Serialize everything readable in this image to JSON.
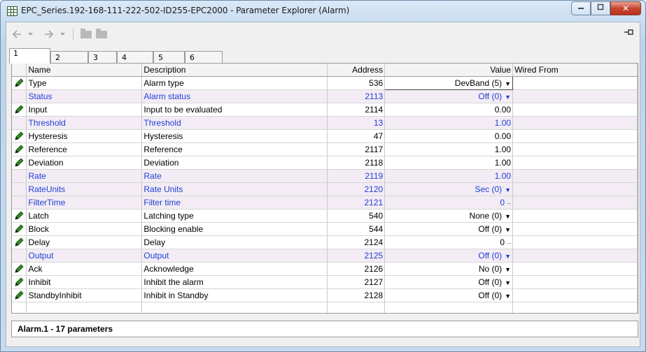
{
  "window": {
    "title": "EPC_Series.192-168-111-222-502-ID255-EPC2000 - Parameter Explorer (Alarm)",
    "close_label": "✕"
  },
  "tabs": [
    {
      "label": "1"
    },
    {
      "label": "2"
    },
    {
      "label": "3"
    },
    {
      "label": "4"
    },
    {
      "label": "5"
    },
    {
      "label": "6"
    }
  ],
  "table": {
    "columns": {
      "name": "Name",
      "description": "Description",
      "address": "Address",
      "value": "Value",
      "wired_from": "Wired From"
    },
    "rows": [
      {
        "name": "Type",
        "description": "Alarm type",
        "address": "536",
        "value": "DevBand (5)",
        "control": "dropdown",
        "editable": true,
        "highlight": false
      },
      {
        "name": "Status",
        "description": "Alarm status",
        "address": "2113",
        "value": "Off (0)",
        "control": "dropdown",
        "editable": false,
        "highlight": true
      },
      {
        "name": "Input",
        "description": "Input to be evaluated",
        "address": "2114",
        "value": "0.00",
        "control": "",
        "editable": true,
        "highlight": false
      },
      {
        "name": "Threshold",
        "description": "Threshold",
        "address": "13",
        "value": "1.00",
        "control": "",
        "editable": false,
        "highlight": true
      },
      {
        "name": "Hysteresis",
        "description": "Hysteresis",
        "address": "47",
        "value": "0.00",
        "control": "",
        "editable": true,
        "highlight": false
      },
      {
        "name": "Reference",
        "description": "Reference",
        "address": "2117",
        "value": "1.00",
        "control": "",
        "editable": true,
        "highlight": false
      },
      {
        "name": "Deviation",
        "description": "Deviation",
        "address": "2118",
        "value": "1.00",
        "control": "",
        "editable": true,
        "highlight": false
      },
      {
        "name": "Rate",
        "description": "Rate",
        "address": "2119",
        "value": "1.00",
        "control": "",
        "editable": false,
        "highlight": true
      },
      {
        "name": "RateUnits",
        "description": "Rate Units",
        "address": "2120",
        "value": "Sec (0)",
        "control": "dropdown",
        "editable": false,
        "highlight": true
      },
      {
        "name": "FilterTime",
        "description": "Filter time",
        "address": "2121",
        "value": "0",
        "control": "ellipsis",
        "editable": false,
        "highlight": true
      },
      {
        "name": "Latch",
        "description": "Latching type",
        "address": "540",
        "value": "None (0)",
        "control": "dropdown",
        "editable": true,
        "highlight": false
      },
      {
        "name": "Block",
        "description": "Blocking enable",
        "address": "544",
        "value": "Off (0)",
        "control": "dropdown",
        "editable": true,
        "highlight": false
      },
      {
        "name": "Delay",
        "description": "Delay",
        "address": "2124",
        "value": "0",
        "control": "ellipsis",
        "editable": true,
        "highlight": false
      },
      {
        "name": "Output",
        "description": "Output",
        "address": "2125",
        "value": "Off (0)",
        "control": "dropdown",
        "editable": false,
        "highlight": true
      },
      {
        "name": "Ack",
        "description": "Acknowledge",
        "address": "2126",
        "value": "No (0)",
        "control": "dropdown",
        "editable": true,
        "highlight": false
      },
      {
        "name": "Inhibit",
        "description": "Inhibit the alarm",
        "address": "2127",
        "value": "Off (0)",
        "control": "dropdown",
        "editable": true,
        "highlight": false
      },
      {
        "name": "StandbyInhibit",
        "description": "Inhibit in Standby",
        "address": "2128",
        "value": "Off (0)",
        "control": "dropdown",
        "editable": true,
        "highlight": false
      }
    ]
  },
  "status": {
    "text": "Alarm.1  -  17 parameters"
  },
  "icons": {
    "back": "arrow-left-icon",
    "forward": "arrow-right-icon",
    "pin": "pin-icon",
    "pencil_color": "#2f8a1f",
    "link_color": "#1f3fd6"
  }
}
